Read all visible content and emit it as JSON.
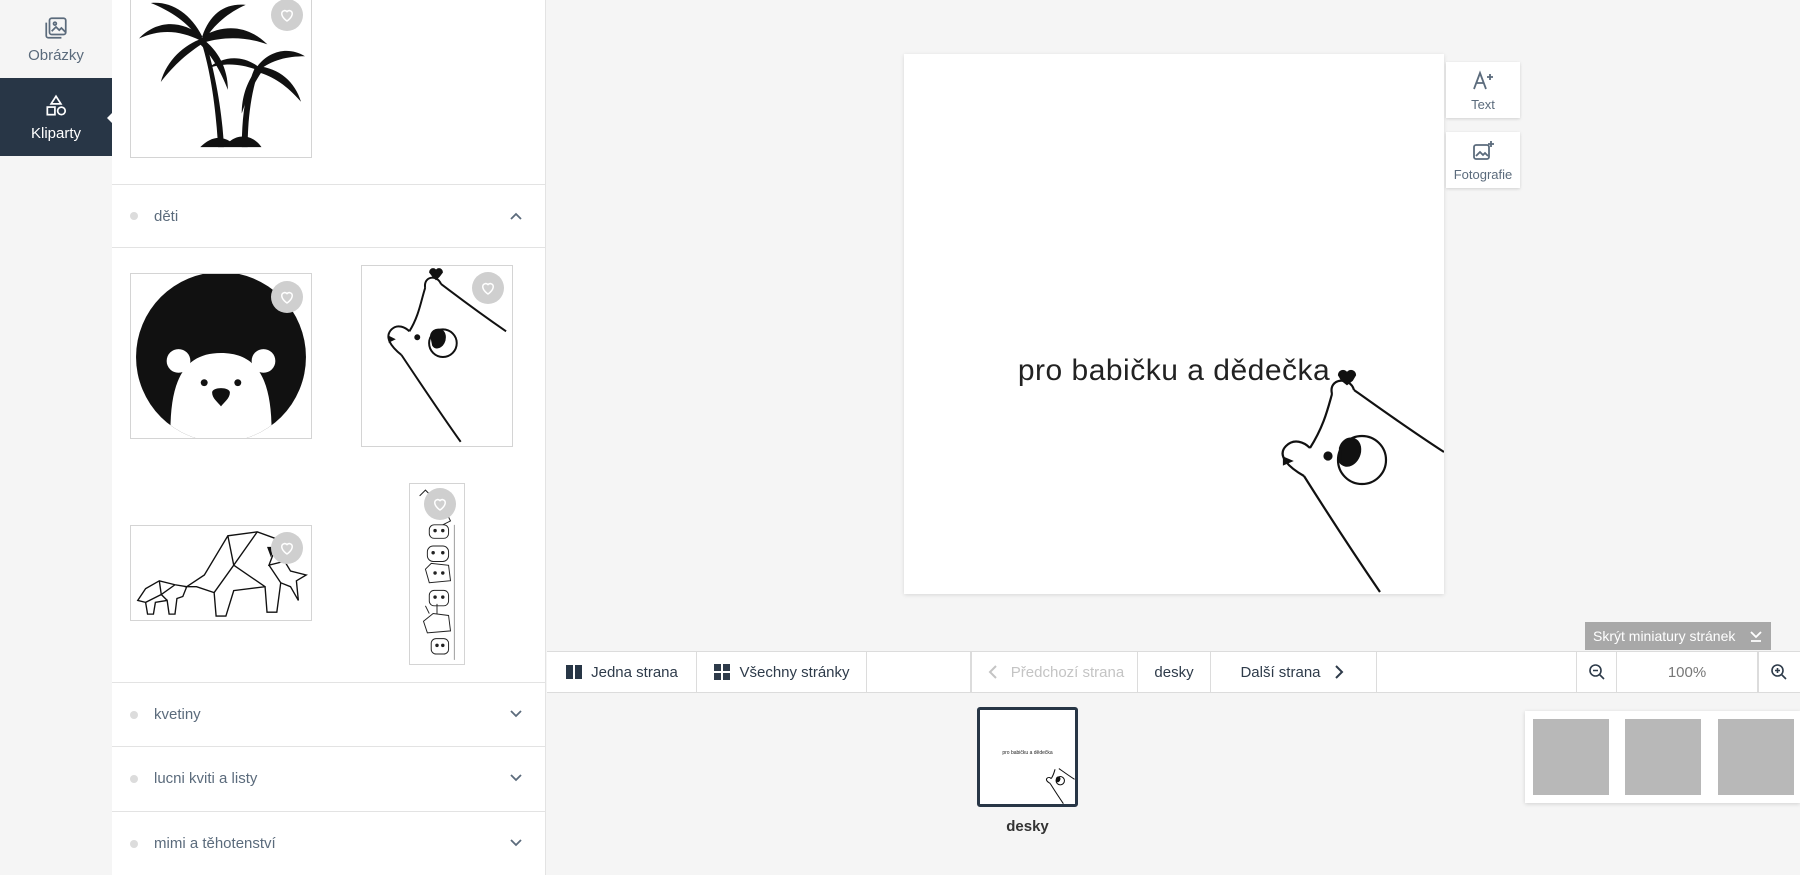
{
  "nav": {
    "items": [
      {
        "label": "Obrázky",
        "icon": "images-icon"
      },
      {
        "label": "Kliparty",
        "icon": "shapes-icon"
      }
    ]
  },
  "panel": {
    "categories": [
      {
        "label": "děti",
        "state": "expanded"
      },
      {
        "label": "kvetiny",
        "state": "collapsed"
      },
      {
        "label": "lucni kviti a listy",
        "state": "collapsed"
      },
      {
        "label": "mimi a těhotenství",
        "state": "collapsed"
      }
    ],
    "cliparts": [
      "palm-trees",
      "bear-in-circle",
      "peeking-bear",
      "origami-elephants",
      "giraffe-stack"
    ]
  },
  "canvas": {
    "page_text": "pro babičku a dědečka"
  },
  "tools": {
    "text_label": "Text",
    "photo_label": "Fotografie"
  },
  "thumbs_toggle": {
    "label": "Skrýt miniatury stránek"
  },
  "toolbar": {
    "single_page": "Jedna strana",
    "all_pages": "Všechny stránky",
    "prev_page": "Předchozí strana",
    "current_page": "desky",
    "next_page": "Další strana",
    "zoom": "100%"
  },
  "strip": {
    "current_label": "desky",
    "mini_text": "pro babičku a dědečka"
  },
  "colors": {
    "accent": "#283646",
    "muted": "#5b6b7c",
    "disabled": "#c4c4c4"
  }
}
